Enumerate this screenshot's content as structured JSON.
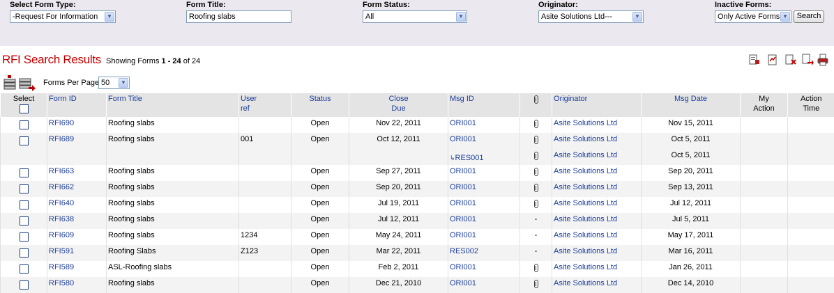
{
  "filters": {
    "form_type": {
      "label": "Select Form Type:",
      "value": "-Request For Information"
    },
    "form_title": {
      "label": "Form Title:",
      "value": "Roofing slabs"
    },
    "form_status": {
      "label": "Form Status:",
      "value": "All"
    },
    "originator": {
      "label": "Originator:",
      "value": "Asite Solutions Ltd---"
    },
    "inactive_forms": {
      "label": "Inactive Forms:",
      "value": "Only Active Forms"
    },
    "search_label": "Search"
  },
  "results": {
    "title": "RFI Search Results",
    "showing_prefix": "Showing Forms",
    "range": "1 - 24",
    "of_label": "of 24",
    "per_page_label": "Forms Per Page",
    "per_page_value": "50"
  },
  "columns": {
    "select": "Select",
    "form_id": "Form ID",
    "form_title": "Form Title",
    "user_ref_1": "User",
    "user_ref_2": "ref",
    "status": "Status",
    "close_due_1": "Close",
    "close_due_2": "Due",
    "msg_id": "Msg ID",
    "originator": "Originator",
    "msg_date": "Msg Date",
    "my_action_1": "My",
    "my_action_2": "Action",
    "action_time_1": "Action",
    "action_time_2": "Time"
  },
  "rows": [
    {
      "id": "RFI690",
      "title": "Roofing slabs",
      "ref": "",
      "status": "Open",
      "due": "Nov 22, 2011",
      "msg": "ORI001",
      "attach": "clip",
      "orig": "Asite Solutions Ltd",
      "date": "Nov 15, 2011"
    },
    {
      "id": "RFI689",
      "title": "Roofing slabs",
      "ref": "001",
      "status": "Open",
      "due": "Oct 12, 2011",
      "msg": "ORI001",
      "attach": "clip",
      "orig": "Asite Solutions Ltd",
      "date": "Oct 5, 2011"
    },
    {
      "id": "",
      "title": "",
      "ref": "",
      "status": "",
      "due": "",
      "msg": "RES001",
      "attach": "clip",
      "orig": "Asite Solutions Ltd",
      "date": "Oct 5, 2011",
      "reply": true
    },
    {
      "id": "RFI663",
      "title": "Roofing slabs",
      "ref": "",
      "status": "Open",
      "due": "Sep 27, 2011",
      "msg": "ORI001",
      "attach": "clip",
      "orig": "Asite Solutions Ltd",
      "date": "Sep 20, 2011"
    },
    {
      "id": "RFI662",
      "title": "Roofing slabs",
      "ref": "",
      "status": "Open",
      "due": "Sep 20, 2011",
      "msg": "ORI001",
      "attach": "clip",
      "orig": "Asite Solutions Ltd",
      "date": "Sep 13, 2011"
    },
    {
      "id": "RFI640",
      "title": "Roofing slabs",
      "ref": "",
      "status": "Open",
      "due": "Jul 19, 2011",
      "msg": "ORI001",
      "attach": "clip",
      "orig": "Asite Solutions Ltd",
      "date": "Jul 12, 2011"
    },
    {
      "id": "RFI638",
      "title": "Roofing slabs",
      "ref": "",
      "status": "Open",
      "due": "Jul 12, 2011",
      "msg": "ORI001",
      "attach": "-",
      "orig": "Asite Solutions Ltd",
      "date": "Jul 5, 2011"
    },
    {
      "id": "RFI609",
      "title": "Roofing slabs",
      "ref": "1234",
      "status": "Open",
      "due": "May 24, 2011",
      "msg": "ORI001",
      "attach": "-",
      "orig": "Asite Solutions Ltd",
      "date": "May 17, 2011"
    },
    {
      "id": "RFI591",
      "title": "Roofing Slabs",
      "ref": "Z123",
      "status": "Open",
      "due": "Mar 22, 2011",
      "msg": "RES002",
      "attach": "-",
      "orig": "Asite Solutions Ltd",
      "date": "Mar 16, 2011"
    },
    {
      "id": "RFI589",
      "title": "ASL-Roofing slabs",
      "ref": "",
      "status": "Open",
      "due": "Feb 2, 2011",
      "msg": "ORI001",
      "attach": "clip",
      "orig": "Asite Solutions Ltd",
      "date": "Jan 26, 2011"
    },
    {
      "id": "RFI580",
      "title": "Roofing slabs",
      "ref": "",
      "status": "Open",
      "due": "Dec 21, 2010",
      "msg": "ORI001",
      "attach": "clip",
      "orig": "Asite Solutions Ltd",
      "date": "Dec 14, 2010"
    }
  ]
}
